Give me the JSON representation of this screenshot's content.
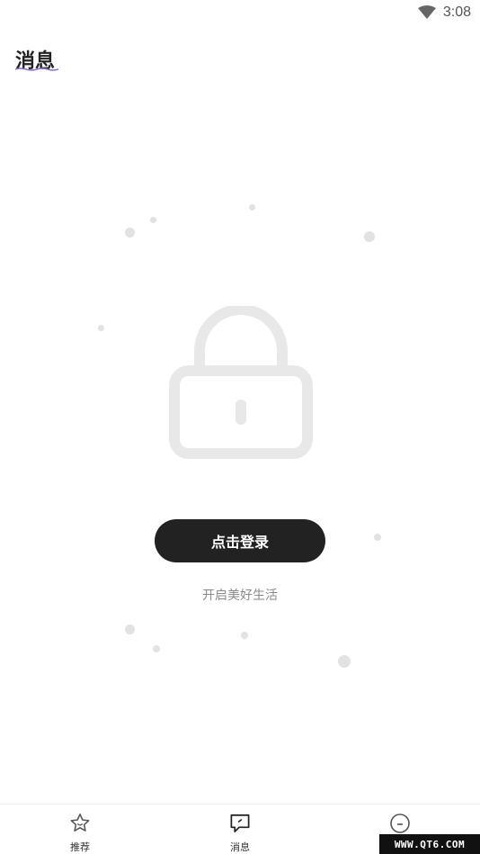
{
  "status_bar": {
    "time": "3:08",
    "wifi_icon": "wifi-icon"
  },
  "header": {
    "title": "消息"
  },
  "empty_state": {
    "icon": "lock-icon",
    "login_button_label": "点击登录",
    "subtitle": "开启美好生活"
  },
  "bottom_nav": {
    "items": [
      {
        "label": "推荐",
        "icon": "star-icon"
      },
      {
        "label": "消息",
        "icon": "message-icon"
      },
      {
        "label": "",
        "icon": "profile-icon"
      }
    ]
  },
  "watermark": {
    "text": "WWW.QT6.COM"
  },
  "colors": {
    "button_bg": "#222222",
    "lock_gray": "#e8e8e8",
    "dot_gray": "#e2e2e2"
  }
}
